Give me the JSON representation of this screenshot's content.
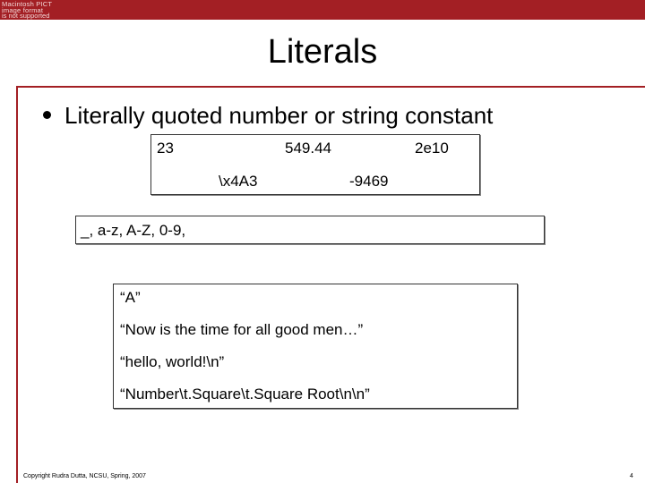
{
  "logo": {
    "line1": "Macintosh PICT",
    "line2": "image format",
    "line3": "is not supported"
  },
  "title": "Literals",
  "bullet": "Literally quoted number or string constant",
  "numbers": {
    "n1": "23",
    "n2": "549.44",
    "n3": "2e10",
    "n4": "\\x4A3",
    "n5": "-9469"
  },
  "identifier_chars": "_, a-z, A-Z, 0-9,",
  "strings": [
    "“A”",
    "“Now is the time for all good men…”",
    "“hello, world!\\n”",
    "“Number\\t.Square\\t.Square Root\\n\\n”"
  ],
  "footer": {
    "copyright": "Copyright Rudra Dutta, NCSU, Spring, 2007",
    "page": "4"
  },
  "colors": {
    "accent": "#a31f24"
  }
}
